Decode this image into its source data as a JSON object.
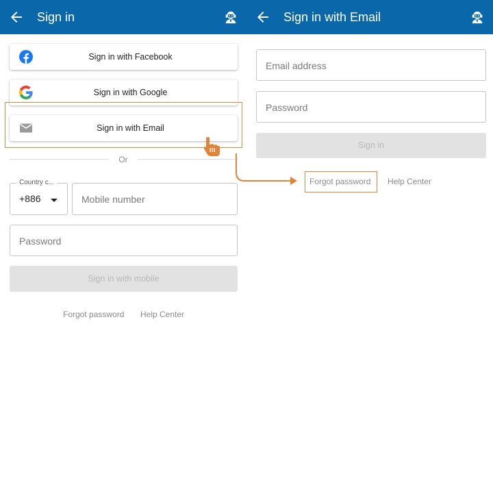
{
  "left_screen": {
    "header": {
      "title": "Sign in",
      "back_icon": "back-arrow-icon",
      "support_icon": "customer-support-icon",
      "color": "#0a67a9"
    },
    "social_buttons": {
      "facebook": "Sign in with Facebook",
      "google": "Sign in with Google",
      "email": "Sign in with Email"
    },
    "divider_text": "Or",
    "country_code": {
      "label": "Country c...",
      "value": "+886"
    },
    "mobile": {
      "placeholder": "Mobile number"
    },
    "password": {
      "placeholder": "Password"
    },
    "submit_label": "Sign in with mobile",
    "links": {
      "forgot": "Forgot password",
      "help": "Help Center"
    }
  },
  "right_screen": {
    "header": {
      "title": "Sign in with Email",
      "back_icon": "back-arrow-icon",
      "support_icon": "customer-support-icon"
    },
    "email": {
      "placeholder": "Email address"
    },
    "password": {
      "placeholder": "Password"
    },
    "submit_label": "Sign in",
    "links": {
      "forgot": "Forgot password",
      "help": "Help Center"
    }
  },
  "annotations": {
    "accent_color": "#e0843a",
    "pointer_icon": "hand-pointer-icon",
    "flow_arrow_icon": "flow-arrow-icon"
  }
}
